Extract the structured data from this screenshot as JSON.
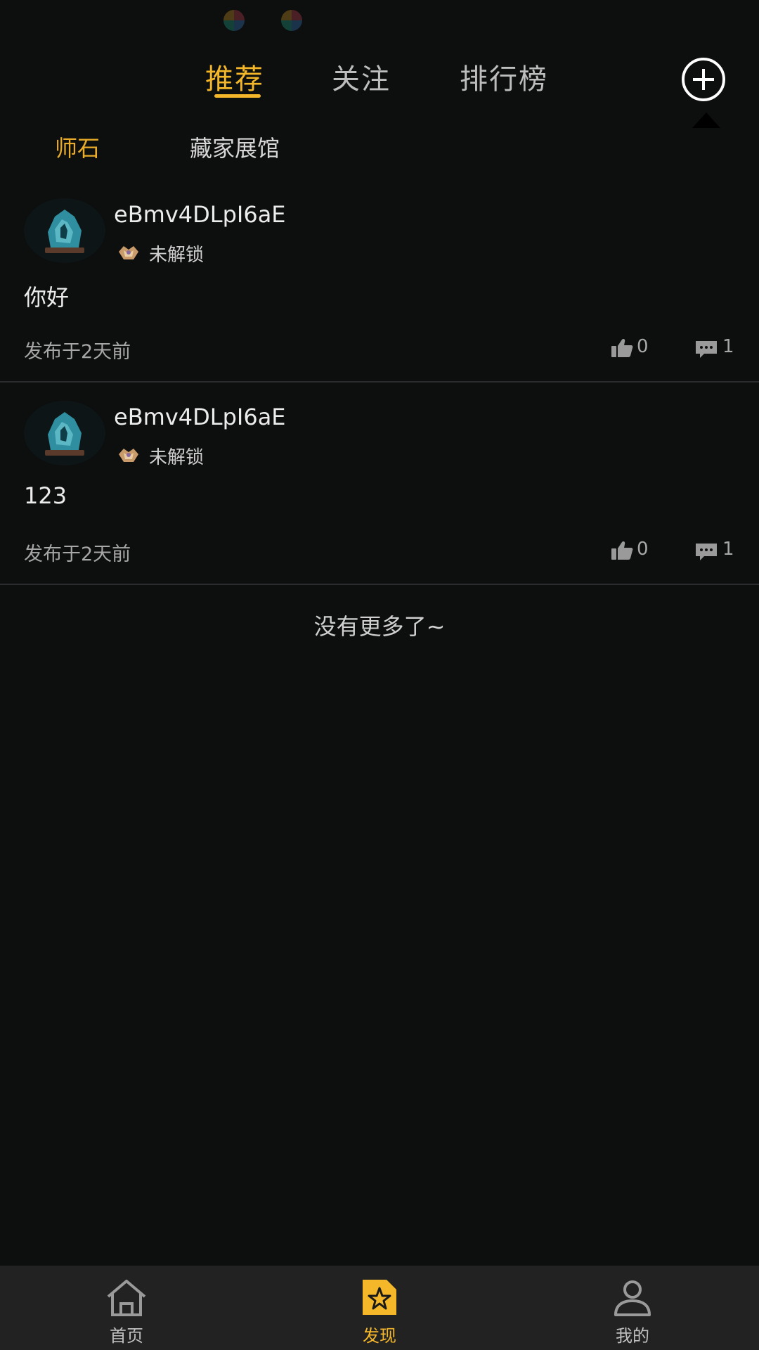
{
  "status_bar": {
    "left_text": "",
    "right_text": ""
  },
  "top_tabs": [
    {
      "label": "推荐",
      "active": true
    },
    {
      "label": "关注",
      "active": false
    },
    {
      "label": "排行榜",
      "active": false
    }
  ],
  "sub_tabs": [
    {
      "label": "师石",
      "active": true
    },
    {
      "label": "藏家展馆",
      "active": false
    }
  ],
  "posts": [
    {
      "username": "eBmv4DLpI6aE",
      "badge": "未解锁",
      "body": "你好",
      "time": "发布于2天前",
      "likes": "0",
      "comments": "1"
    },
    {
      "username": "eBmv4DLpI6aE",
      "badge": "未解锁",
      "body": "123",
      "time": "发布于2天前",
      "likes": "0",
      "comments": "1"
    }
  ],
  "footer_text": "没有更多了~",
  "bottom_nav": [
    {
      "label": "首页",
      "icon": "home-icon",
      "active": false
    },
    {
      "label": "发现",
      "icon": "discover-star-icon",
      "active": true
    },
    {
      "label": "我的",
      "icon": "user-icon",
      "active": false
    }
  ],
  "colors": {
    "accent": "#f5b72a",
    "background": "#0d0e0e",
    "nav_background": "#232222"
  }
}
